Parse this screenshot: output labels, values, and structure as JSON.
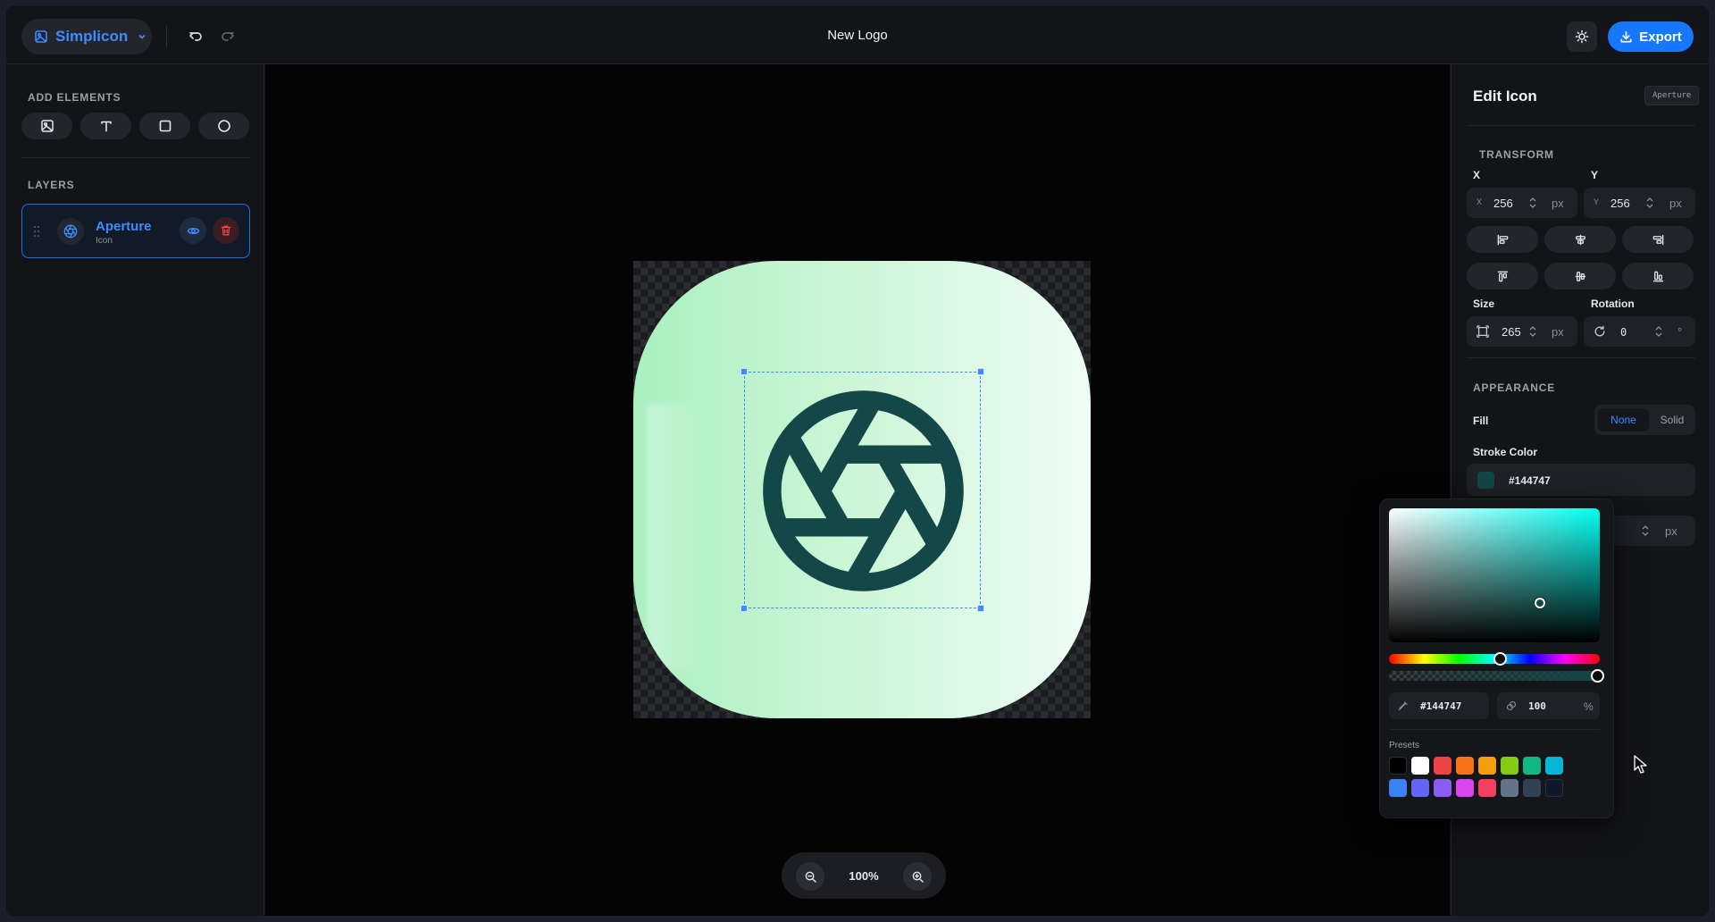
{
  "header": {
    "brand": "Simplicon",
    "title": "New Logo",
    "export_label": "Export"
  },
  "left_panel": {
    "add_elements_label": "ADD ELEMENTS",
    "tools": [
      "image-tool",
      "text-tool",
      "rectangle-tool",
      "circle-tool"
    ],
    "layers_label": "LAYERS",
    "layers": [
      {
        "name": "Aperture",
        "type": "Icon",
        "selected": true
      }
    ]
  },
  "canvas": {
    "zoom": "100%",
    "icon": "aperture-icon",
    "background_gradient": [
      "#a9f0c0",
      "#eefcf4"
    ]
  },
  "right_panel": {
    "title": "Edit Icon",
    "badge": "Aperture",
    "transform_label": "TRANSFORM",
    "x_label": "X",
    "x_prefix": "X",
    "x_value": "256",
    "y_label": "Y",
    "y_prefix": "Y",
    "y_value": "256",
    "unit_px": "px",
    "size_label": "Size",
    "size_value": "265",
    "rotation_label": "Rotation",
    "rotation_value": "0",
    "rotation_unit": "°",
    "appearance_label": "APPEARANCE",
    "fill_label": "Fill",
    "fill_options": [
      "None",
      "Solid"
    ],
    "fill_selected": "None",
    "stroke_color_label": "Stroke Color",
    "stroke_color": "#144747"
  },
  "color_picker": {
    "hex": "#144747",
    "alpha": "100",
    "alpha_unit": "%",
    "presets_label": "Presets",
    "presets": [
      "#000000",
      "#ffffff",
      "#ef4444",
      "#f97316",
      "#f59e0b",
      "#84cc16",
      "#10b981",
      "#06b6d4",
      "#3b82f6",
      "#6366f1",
      "#8b5cf6",
      "#d946ef",
      "#f43f5e",
      "#64748b",
      "#334155",
      "#0f172a"
    ]
  },
  "colors": {
    "accent": "#1677ff",
    "stroke": "#144747"
  }
}
